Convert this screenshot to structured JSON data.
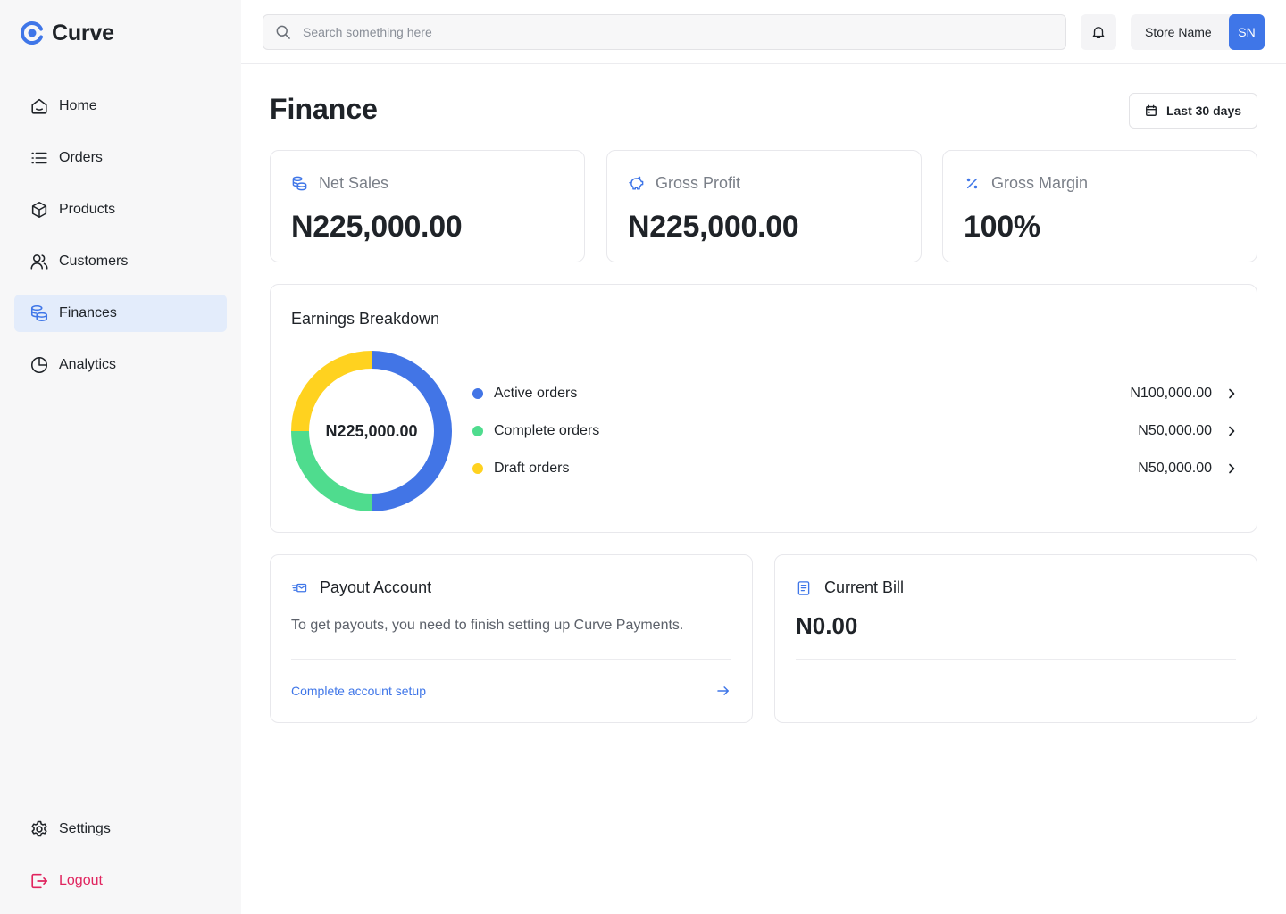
{
  "app": {
    "name": "Curve"
  },
  "colors": {
    "accent": "#3f76e8",
    "active_bg": "#e3ecfb",
    "logout": "#e0245e",
    "blue": "#4275e6",
    "green": "#4fdc8e",
    "yellow": "#ffd21f"
  },
  "sidebar": {
    "items": [
      {
        "label": "Home",
        "icon": "home-icon"
      },
      {
        "label": "Orders",
        "icon": "list-icon"
      },
      {
        "label": "Products",
        "icon": "box-icon"
      },
      {
        "label": "Customers",
        "icon": "users-icon"
      },
      {
        "label": "Finances",
        "icon": "coins-icon",
        "active": true
      },
      {
        "label": "Analytics",
        "icon": "pie-chart-icon"
      }
    ],
    "bottom": [
      {
        "label": "Settings",
        "icon": "gear-icon"
      },
      {
        "label": "Logout",
        "icon": "logout-icon"
      }
    ]
  },
  "header": {
    "search_placeholder": "Search something here",
    "store_name": "Store Name",
    "avatar_initials": "SN"
  },
  "page": {
    "title": "Finance",
    "date_range": "Last 30 days"
  },
  "stats": [
    {
      "label": "Net Sales",
      "value": "N225,000.00",
      "icon": "coins-icon"
    },
    {
      "label": "Gross Profit",
      "value": "N225,000.00",
      "icon": "piggy-bank-icon"
    },
    {
      "label": "Gross Margin",
      "value": "100%",
      "icon": "percent-icon"
    }
  ],
  "earnings": {
    "title": "Earnings Breakdown",
    "total": "N225,000.00",
    "rows": [
      {
        "label": "Active orders",
        "value": "N100,000.00",
        "amount": 100000,
        "color": "#4275e6"
      },
      {
        "label": "Complete orders",
        "value": "N50,000.00",
        "amount": 50000,
        "color": "#4fdc8e"
      },
      {
        "label": "Draft orders",
        "value": "N50,000.00",
        "amount": 50000,
        "color": "#ffd21f"
      }
    ]
  },
  "payout": {
    "title": "Payout Account",
    "text": "To get payouts, you need to finish setting up Curve Payments.",
    "link": "Complete account setup"
  },
  "bill": {
    "title": "Current Bill",
    "value": "N0.00"
  }
}
